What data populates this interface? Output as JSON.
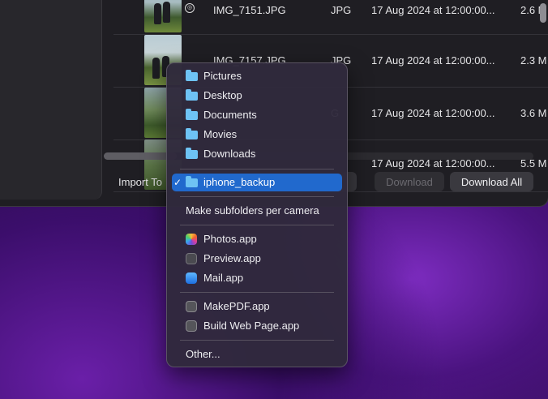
{
  "files": [
    {
      "name": "IMG_7151.JPG",
      "kind": "JPG",
      "date": "17 Aug 2024 at 12:00:00...",
      "size": "2.6 M"
    },
    {
      "name": "IMG_7157.JPG",
      "kind": "JPG",
      "date": "17 Aug 2024 at 12:00:00...",
      "size": "2.3 M"
    },
    {
      "name": "",
      "kind": "G",
      "date": "17 Aug 2024 at 12:00:00...",
      "size": "3.6 M"
    },
    {
      "name": "",
      "kind": "",
      "date": "17 Aug 2024 at 12:00:00...",
      "size": "5.5 M"
    }
  ],
  "bottom_bar": {
    "import_to_label": "Import To",
    "download_label": "Download",
    "download_all_label": "Download All"
  },
  "menu": {
    "folders": [
      "Pictures",
      "Desktop",
      "Documents",
      "Movies",
      "Downloads"
    ],
    "selected_folder": "iphone_backup",
    "checkmark": "✓",
    "subfolders_option": "Make subfolders per camera",
    "apps": [
      "Photos.app",
      "Preview.app",
      "Mail.app"
    ],
    "automator": [
      "MakePDF.app",
      "Build Web Page.app"
    ],
    "other": "Other..."
  },
  "icons": {
    "folder_color": "#6ec3f4",
    "selection_color": "#2169cd"
  }
}
